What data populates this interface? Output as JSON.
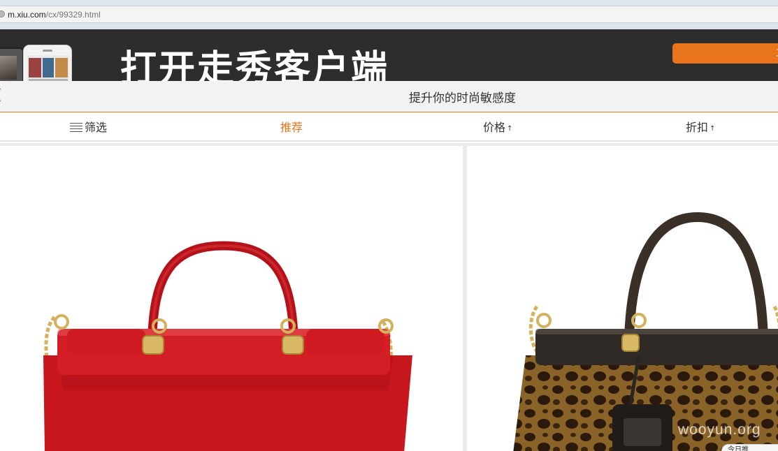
{
  "browser": {
    "url_host": "m.xiu.com",
    "url_path": "/cx/99329.html"
  },
  "banner": {
    "title": "打开走秀客户端",
    "button_label": "立"
  },
  "header": {
    "title": "提升你的时尚敏感度"
  },
  "sort_bar": {
    "filter_label": "筛选",
    "recommend_label": "推荐",
    "price_label": "价格",
    "price_arrow": "↑",
    "discount_label": "折扣",
    "discount_arrow": "↑",
    "active_tab": "推荐"
  },
  "products": [
    {
      "image": "red-leather-handbag",
      "color": "#c8161d"
    },
    {
      "image": "leopard-print-handbag",
      "color": "#6b4a22"
    }
  ],
  "watermark": "wooyun.org",
  "floating_badge": "今日推"
}
